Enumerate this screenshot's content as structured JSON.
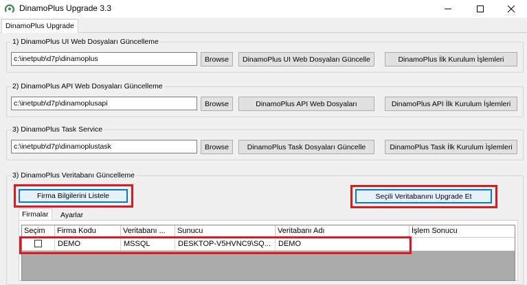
{
  "window": {
    "title": "DinamoPlus Upgrade 3.3",
    "controls": [
      "minimize-icon",
      "maximize-icon",
      "close-icon"
    ]
  },
  "main_tab": {
    "label": "DinamoPlus Upgrade"
  },
  "sections": {
    "ui": {
      "title": "1) DinamoPlus UI Web Dosyaları Güncelleme",
      "path_value": "c:\\inetpub\\d7p\\dinamoplus",
      "browse_label": "Browse",
      "update_label": "DinamoPlus UI Web Dosyaları Güncelle",
      "setup_label": "DinamoPlus İlk Kurulum İşlemleri"
    },
    "api": {
      "title": "2) DinamoPlus API Web Dosyaları Güncelleme",
      "path_value": "c:\\inetpub\\d7p\\dinamoplusapi",
      "browse_label": "Browse",
      "update_label": "DinamoPlus API Web Dosyaları",
      "setup_label": "DinamoPlus API İlk Kurulum İşlemleri"
    },
    "task": {
      "title": "3) DinamoPlus Task Service",
      "path_value": "c:\\inetpub\\d7p\\dinamoplustask",
      "browse_label": "Browse",
      "update_label": "DinamoPlus Task Dosyaları Güncelle",
      "setup_label": "DinamoPlus Task İlk Kurulum İşlemleri"
    },
    "db": {
      "title": "3) DinamoPlus Veritabanı Güncelleme",
      "list_label": "Firma Bilgilerini Listele",
      "upgrade_label": "Seçili Veritabanını Upgrade Et",
      "tabs": [
        "Firmalar",
        "Ayarlar"
      ],
      "columns": [
        "Seçim",
        "Firma Kodu",
        "Veritabanı ...",
        "Sunucu",
        "Veritabanı Adı",
        "İşlem Sonucu"
      ],
      "rows": [
        {
          "selected": false,
          "firma_kodu": "DEMO",
          "veritabani_tipi": "MSSQL",
          "sunucu": "DESKTOP-V5HVNC9\\SQ...",
          "veritabani_adi": "DEMO",
          "islem_sonucu": ""
        }
      ]
    }
  },
  "colors": {
    "highlight_border": "#e3151d",
    "focus_blue": "#0078d7"
  }
}
